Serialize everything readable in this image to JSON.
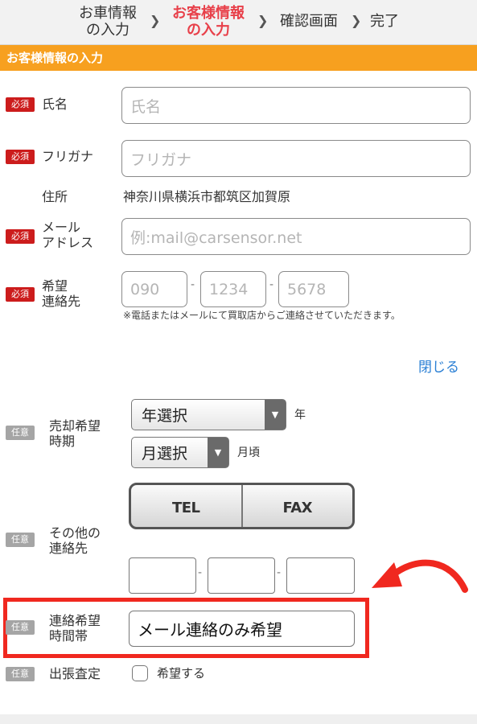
{
  "steps": [
    {
      "line1": "お車情報",
      "line2": "の入力"
    },
    {
      "line1": "お客様情報",
      "line2": "の入力"
    },
    {
      "line1": "確認画面"
    },
    {
      "line1": "完了"
    }
  ],
  "section_title": "お客様情報の入力",
  "badges": {
    "required": "必須",
    "optional": "任意"
  },
  "fields": {
    "name": {
      "label": "氏名",
      "placeholder": "氏名"
    },
    "furigana": {
      "label": "フリガナ",
      "placeholder": "フリガナ"
    },
    "address": {
      "label": "住所",
      "value": "神奈川県横浜市都筑区加賀原"
    },
    "email": {
      "label_line1": "メール",
      "label_line2": "アドレス",
      "placeholder": "例:mail@carsensor.net"
    },
    "phone": {
      "label_line1": "希望",
      "label_line2": "連絡先",
      "parts": [
        "090",
        "1234",
        "5678"
      ],
      "note": "※電話またはメールにて買取店からご連絡させていただきます。"
    }
  },
  "close_link": "閉じる",
  "sale_period": {
    "label_line1": "売却希望",
    "label_line2": "時期",
    "year_select": "年選択",
    "year_suffix": "年",
    "month_select": "月選択",
    "month_suffix": "月頃"
  },
  "other_contact": {
    "label_line1": "その他の",
    "label_line2": "連絡先",
    "tel": "TEL",
    "fax": "FAX"
  },
  "contact_time": {
    "label_line1": "連絡希望",
    "label_line2": "時間帯",
    "value": "メール連絡のみ希望"
  },
  "appraisal": {
    "label": "出張査定",
    "checkbox_label": "希望する"
  },
  "colors": {
    "accent": "#f7a01f",
    "required": "#cc1c1c",
    "highlight": "#f0281f",
    "link": "#2a7fd4"
  }
}
